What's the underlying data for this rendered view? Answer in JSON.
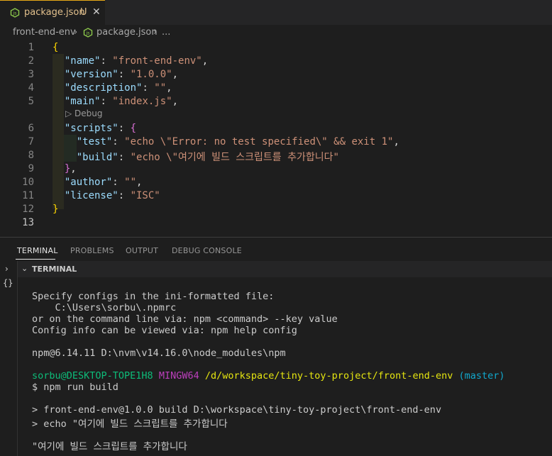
{
  "tab": {
    "filename": "package.json",
    "badge": "U",
    "close_glyph": "✕"
  },
  "breadcrumb": {
    "folder": "front-end-env",
    "file": "package.json",
    "more": "..."
  },
  "editor": {
    "line_numbers": [
      "1",
      "2",
      "3",
      "4",
      "5",
      "6",
      "7",
      "8",
      "9",
      "10",
      "11",
      "12",
      "13"
    ],
    "codelens": "▷ Debug",
    "lines": {
      "l1_brace": "{",
      "name_key": "\"name\"",
      "name_val": "\"front-end-env\"",
      "version_key": "\"version\"",
      "version_val": "\"1.0.0\"",
      "description_key": "\"description\"",
      "description_val": "\"\"",
      "main_key": "\"main\"",
      "main_val": "\"index.js\"",
      "scripts_key": "\"scripts\"",
      "scripts_brace": "{",
      "test_key": "\"test\"",
      "test_val": "\"echo \\\"Error: no test specified\\\" && exit 1\"",
      "build_key": "\"build\"",
      "build_val": "\"echo \\\"여기에 빌드 스크립트를 추가합니다\"",
      "scripts_close": "}",
      "author_key": "\"author\"",
      "author_val": "\"\"",
      "license_key": "\"license\"",
      "license_val": "\"ISC\"",
      "l12_brace": "}"
    }
  },
  "panel": {
    "tabs": [
      "TERMINAL",
      "PROBLEMS",
      "OUTPUT",
      "DEBUG CONSOLE"
    ],
    "terminal_header": "TERMINAL"
  },
  "terminal": {
    "line1": "Specify configs in the ini-formatted file:",
    "line2": "    C:\\Users\\sorbu\\.npmrc",
    "line3": "or on the command line via: npm <command> --key value",
    "line4": "Config info can be viewed via: npm help config",
    "line5": "npm@6.14.11 D:\\nvm\\v14.16.0\\node_modules\\npm",
    "prompt_user": "sorbu@DESKTOP-TOPE1H8",
    "prompt_env": "MINGW64",
    "prompt_path": "/d/workspace/tiny-toy-project/front-end-env",
    "prompt_branch": "(master)",
    "command": "$ npm run build",
    "out1": "> front-end-env@1.0.0 build D:\\workspace\\tiny-toy-project\\front-end-env",
    "out2": "> echo \"여기에 빌드 스크립트를 추가합니다",
    "out3": "\"여기에 빌드 스크립트를 추가합니다"
  },
  "colors": {
    "accent": "#e6a817",
    "background": "#1e1e1e",
    "green": "#0dbc79",
    "magenta": "#bc3fbc",
    "yellow": "#e5e510",
    "cyan": "#11a8cd"
  }
}
